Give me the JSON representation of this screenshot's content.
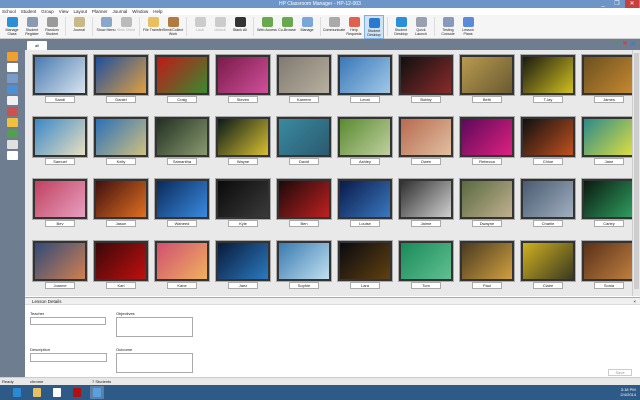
{
  "window": {
    "title": "HP Classroom Manager - HP-12-003",
    "controls": [
      "_",
      "❐",
      "✕"
    ]
  },
  "menu": [
    "School",
    "Student",
    "Group",
    "View",
    "Layout",
    "Planner",
    "Journal",
    "Window",
    "Help"
  ],
  "ribbon": [
    {
      "label": "Manage Class",
      "color": "#2a8fd6"
    },
    {
      "label": "Student Register",
      "color": "#8a9ab0"
    },
    {
      "label": "Random Student",
      "color": "#9a9a9a"
    },
    {
      "sep": true
    },
    {
      "label": "Journal",
      "color": "#c8b88a"
    },
    {
      "sep": true
    },
    {
      "label": "Show Menu",
      "color": "#8aa6c8"
    },
    {
      "label": "View Client",
      "color": "#bbbbbb",
      "disabled": true
    },
    {
      "sep": true
    },
    {
      "label": "File Transfer",
      "color": "#e8c060"
    },
    {
      "label": "Send/Collect Work",
      "color": "#b07a40"
    },
    {
      "sep": true
    },
    {
      "label": "Lock",
      "color": "#cccccc",
      "disabled": true
    },
    {
      "label": "Unlock",
      "color": "#cccccc",
      "disabled": true
    },
    {
      "label": "Blank All",
      "color": "#333333"
    },
    {
      "sep": true
    },
    {
      "label": "Web Access",
      "color": "#6aa84f"
    },
    {
      "label": "Co-Browse",
      "color": "#6aa84f"
    },
    {
      "label": "Manage",
      "color": "#7aa7d8"
    },
    {
      "sep": true
    },
    {
      "label": "Communicate",
      "color": "#aaaaaa"
    },
    {
      "label": "Help Requests",
      "color": "#e06050"
    },
    {
      "label": "Student Desktop",
      "color": "#2a7ad0",
      "selected": true
    },
    {
      "sep": true
    },
    {
      "label": "Student Desktop",
      "color": "#2a8fd6"
    },
    {
      "label": "Quick Launch",
      "color": "#9aa0b0"
    },
    {
      "sep": true
    },
    {
      "label": "Testing Console",
      "color": "#8899bb"
    },
    {
      "label": "Lesson Plans",
      "color": "#5a8ad8"
    }
  ],
  "tab": {
    "label": "all"
  },
  "tab_icons": [
    {
      "name": "add-icon",
      "glyph": "+",
      "color": "#3aa53a"
    },
    {
      "name": "remove-icon",
      "glyph": "✖",
      "color": "#d04040"
    },
    {
      "name": "window-icon",
      "glyph": "▣",
      "color": "#4a7ab8"
    }
  ],
  "sidebar_icons": [
    "grid-view",
    "thumbnails",
    "headphones",
    "globe",
    "calendar",
    "printer",
    "bulb",
    "user-voice",
    "keyboard",
    "chart"
  ],
  "students": [
    {
      "name": "Sandi",
      "c": [
        "#4a7ab0",
        "#d8e4ef"
      ]
    },
    {
      "name": "Daniel",
      "c": [
        "#1d4fa0",
        "#e0a040"
      ]
    },
    {
      "name": "Craig",
      "c": [
        "#c01818",
        "#3a8a30"
      ]
    },
    {
      "name": "Steven",
      "c": [
        "#7a1a4a",
        "#d0509a"
      ]
    },
    {
      "name": "Kareem",
      "c": [
        "#807a70",
        "#b8b0a0"
      ]
    },
    {
      "name": "Leoni",
      "c": [
        "#3a78b8",
        "#a0c8e8"
      ]
    },
    {
      "name": "Bobby",
      "c": [
        "#101010",
        "#8a2a2a"
      ]
    },
    {
      "name": "Beth",
      "c": [
        "#b89a50",
        "#6a5a30"
      ]
    },
    {
      "name": "T-lay",
      "c": [
        "#1a1a10",
        "#d0c020"
      ]
    },
    {
      "name": "James",
      "c": [
        "#6a5020",
        "#c88a30"
      ]
    },
    {
      "name": "Samuel",
      "c": [
        "#3a88c8",
        "#e8e0c0"
      ]
    },
    {
      "name": "Kelly",
      "c": [
        "#2a70b8",
        "#d0c080"
      ]
    },
    {
      "name": "Samantha",
      "c": [
        "#203020",
        "#8a9a70"
      ]
    },
    {
      "name": "Wayne",
      "c": [
        "#0a1a1a",
        "#d8c030"
      ]
    },
    {
      "name": "David",
      "c": [
        "#3a8aa0",
        "#2a5a70"
      ]
    },
    {
      "name": "Ashley",
      "c": [
        "#5a8a30",
        "#c0d0a0"
      ]
    },
    {
      "name": "Owen",
      "c": [
        "#b86a50",
        "#e0c0a0"
      ]
    },
    {
      "name": "Rebecca",
      "c": [
        "#5a0a5a",
        "#e02080"
      ]
    },
    {
      "name": "Chloe",
      "c": [
        "#101010",
        "#c05020"
      ]
    },
    {
      "name": "Jane",
      "c": [
        "#2a8a8a",
        "#e0e040"
      ]
    },
    {
      "name": "Bev",
      "c": [
        "#c04060",
        "#e8a0c0"
      ]
    },
    {
      "name": "Jason",
      "c": [
        "#401010",
        "#e07020"
      ]
    },
    {
      "name": "Waheed",
      "c": [
        "#0a2a5a",
        "#3a8ae0"
      ]
    },
    {
      "name": "Kyle",
      "c": [
        "#0a0a0a",
        "#3a3a3a"
      ]
    },
    {
      "name": "Ben",
      "c": [
        "#1a0a0a",
        "#c02020"
      ]
    },
    {
      "name": "Louise",
      "c": [
        "#0a1a4a",
        "#3a78c0"
      ]
    },
    {
      "name": "Jaime",
      "c": [
        "#303030",
        "#d0d0d0"
      ]
    },
    {
      "name": "Dwayne",
      "c": [
        "#5a6a40",
        "#c0b090"
      ]
    },
    {
      "name": "Charlie",
      "c": [
        "#4a5a70",
        "#a0b0c0"
      ]
    },
    {
      "name": "Carley",
      "c": [
        "#0a1a10",
        "#30a060"
      ]
    },
    {
      "name": "Joanne",
      "c": [
        "#304a7a",
        "#d08050"
      ]
    },
    {
      "name": "Karl",
      "c": [
        "#3a0808",
        "#c01010"
      ]
    },
    {
      "name": "Kane",
      "c": [
        "#d05070",
        "#f0b060"
      ]
    },
    {
      "name": "Jaez",
      "c": [
        "#0a1a3a",
        "#2a7ac0"
      ]
    },
    {
      "name": "Sophie",
      "c": [
        "#3a7ab0",
        "#c0e0f0"
      ]
    },
    {
      "name": "Lara",
      "c": [
        "#0a0a10",
        "#604010"
      ]
    },
    {
      "name": "Tom",
      "c": [
        "#1a8a5a",
        "#60c090"
      ]
    },
    {
      "name": "Paul",
      "c": [
        "#4a3a20",
        "#d0a040"
      ]
    },
    {
      "name": "Claire",
      "c": [
        "#d0b020",
        "#3a3a20"
      ]
    },
    {
      "name": "Sonia",
      "c": [
        "#5a3018",
        "#c08040"
      ]
    }
  ],
  "lesson": {
    "title": "Lesson Details",
    "teacher_label": "Teacher",
    "teacher_value": "",
    "objectives_label": "Objectives",
    "objectives_value": "",
    "description_label": "Description",
    "description_value": "",
    "outcome_label": "Outcome",
    "outcome_value": "",
    "save_label": "Save"
  },
  "status": {
    "ready": "Ready",
    "user": "chrome",
    "students": "7 Students"
  },
  "taskbar": {
    "apps": [
      {
        "name": "internet-explorer-icon",
        "color": "#2a8ad8"
      },
      {
        "name": "file-explorer-icon",
        "color": "#e8c060"
      },
      {
        "name": "amazon-icon",
        "color": "#ffffff"
      },
      {
        "name": "security-app-icon",
        "color": "#b01010"
      },
      {
        "name": "classroom-manager-icon",
        "color": "#5aa0e0"
      }
    ],
    "time": "3:18 PM",
    "date": "2/4/2014"
  }
}
